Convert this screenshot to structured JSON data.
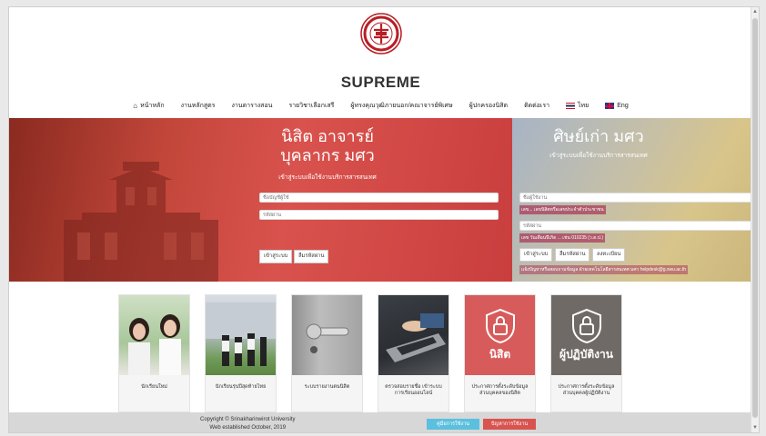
{
  "header": {
    "site_title": "SUPREME"
  },
  "nav": {
    "items": [
      {
        "label": "หน้าหลัก",
        "icon": "home-icon"
      },
      {
        "label": "งานหลักสูตร"
      },
      {
        "label": "งานตารางสอน"
      },
      {
        "label": "รายวิชาเลือกเสรี"
      },
      {
        "label": "ผู้ทรงคุณวุฒิภายนอก/คณาจารย์พิเศษ"
      },
      {
        "label": "ผู้ปกครองนิสิต"
      },
      {
        "label": "ติดต่อเรา"
      },
      {
        "label": "ไทย",
        "icon": "flag-th-icon"
      },
      {
        "label": "Eng",
        "icon": "flag-en-icon"
      }
    ]
  },
  "hero_left": {
    "title_line1": "นิสิต อาจารย์",
    "title_line2": "บุคลากร มศว",
    "subtitle": "เข้าสู่ระบบเพื่อใช้งานบริการสารสนเทศ",
    "username_placeholder": "ชื่อบัญชีผู้ใช้",
    "password_placeholder": "รหัสผ่าน",
    "login_label": "เข้าสู่ระบบ",
    "forgot_label": "ลืมรหัสผ่าน"
  },
  "hero_right": {
    "title": "ศิษย์เก่า มศว",
    "subtitle": "เข้าสู่ระบบเพื่อใช้งานบริการสารสนเทศ",
    "username_placeholder": "ชื่อผู้ใช้งาน",
    "username_hint": "เลข... เลขนิสิตหรือเลขประจำตัวประชาชน",
    "password_placeholder": "รหัสผ่าน",
    "password_hint": "เลข วันเดือนปีเกิด ... เช่น 010235 (ว.ด.ป.)",
    "login_label": "เข้าสู่ระบบ",
    "forgot_label": "ลืมรหัสผ่าน",
    "register_label": "ลงทะเบียน",
    "contact_note": "แจ้งปัญหาหรือสอบถามข้อมูล ฝ่ายเทคโนโลยีสารสนเทศ มศว helpdesk@g.swu.ac.th"
  },
  "cards": [
    {
      "caption": "นักเรียนใหม่",
      "icon": "students-photo"
    },
    {
      "caption": "นักเรียนรุ่นปีสุดท้ายไทย",
      "icon": "graduates-photo"
    },
    {
      "caption": "ระบบรายงานตนนิสิต",
      "icon": "door-handle-photo"
    },
    {
      "caption": "ตรวจสอบรายชื่อ เข้าระบบการเรียนออนไลน์",
      "icon": "laptop-typing-photo"
    },
    {
      "caption": "ประกาศการตั้งระดับข้อมูลส่วนบุคคลของนิสิต",
      "icon": "shield-lock-icon",
      "label": "นิสิต",
      "color": "#d85b5b"
    },
    {
      "caption": "ประกาศการตั้งระดับข้อมูลส่วนบุคคลผู้ปฏิบัติงาน",
      "icon": "shield-lock-icon",
      "label": "ผู้ปฏิบัติงาน",
      "color": "#6f6a66"
    }
  ],
  "footer": {
    "copyright_line1": "Copyright © Srinakharinwirot University",
    "copyright_line2": "Web established October, 2019",
    "manual_label": "คู่มือการใช้งาน",
    "trouble_label": "ปัญหาการใช้งาน",
    "manual_color": "#5bc0de",
    "trouble_color": "#d9534f"
  }
}
